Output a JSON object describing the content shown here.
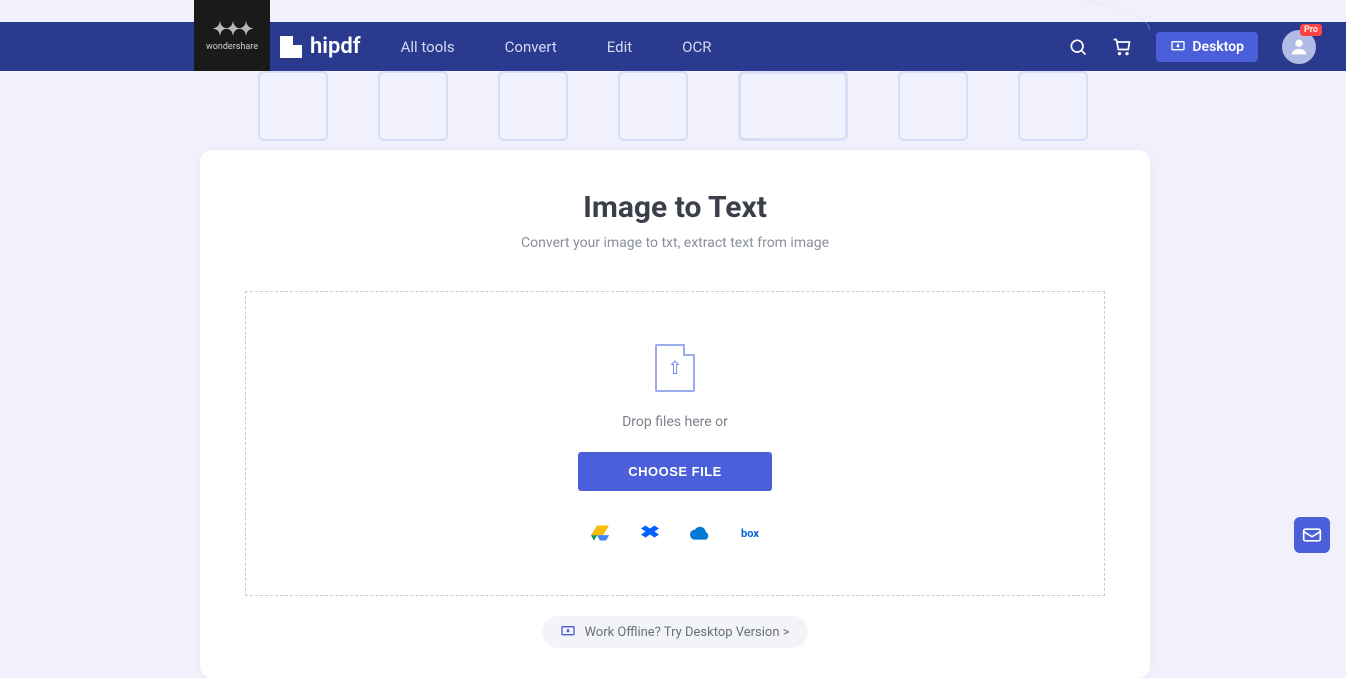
{
  "brand": {
    "parent": "wondershare",
    "name": "hipdf"
  },
  "nav": {
    "links": [
      "All tools",
      "Convert",
      "Edit",
      "OCR"
    ],
    "desktop_label": "Desktop",
    "pro_badge": "Pro"
  },
  "page": {
    "title": "Image to Text",
    "subtitle": "Convert your image to txt, extract text from image"
  },
  "dropzone": {
    "drop_text": "Drop files here or",
    "choose_label": "CHOOSE FILE",
    "clouds": [
      "google-drive",
      "dropbox",
      "onedrive",
      "box"
    ]
  },
  "offline": {
    "text": "Work Offline? Try Desktop Version >"
  }
}
